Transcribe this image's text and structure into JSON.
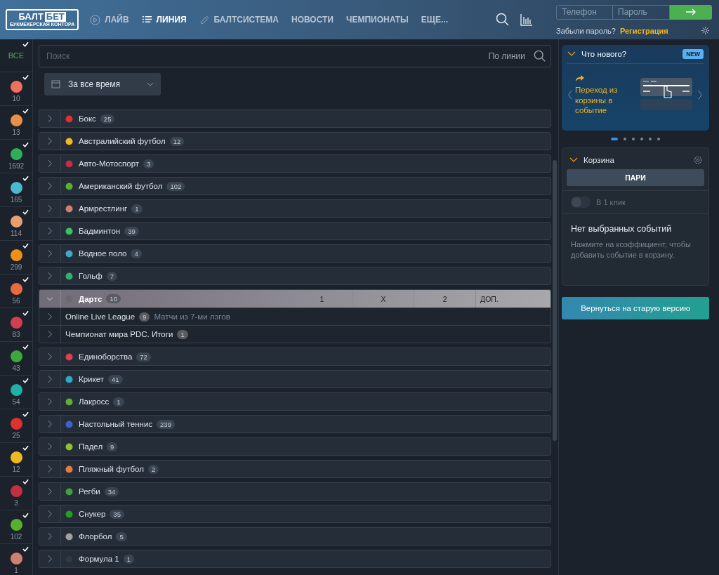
{
  "header": {
    "logo": {
      "top": "БАЛТ",
      "box": "БЕТ",
      "bottom": "БУКМЕКЕРСКАЯ КОНТОРА"
    },
    "nav": [
      {
        "label": "ЛАЙВ",
        "selected": false
      },
      {
        "label": "ЛИНИЯ",
        "selected": true
      },
      {
        "label": "БАЛТСИСТЕМА",
        "selected": false
      },
      {
        "label": "НОВОСТИ",
        "selected": false
      },
      {
        "label": "ЧЕМПИОНАТЫ",
        "selected": false
      },
      {
        "label": "ЕЩЕ...",
        "selected": false
      }
    ],
    "login": {
      "phone_placeholder": "Телефон",
      "password_placeholder": "Пароль",
      "forgot": "Забыли пароль?",
      "register": "Регистрация"
    }
  },
  "rail": [
    {
      "label": "ВСЕ",
      "checked": true
    },
    {
      "count": "10",
      "color": "#f07060",
      "checked": true
    },
    {
      "count": "13",
      "color": "#e8904a",
      "checked": true
    },
    {
      "count": "1692",
      "color": "#2fae5a",
      "checked": true
    },
    {
      "count": "165",
      "color": "#4bb8d0",
      "checked": true
    },
    {
      "count": "114",
      "color": "#e8a070",
      "checked": true
    },
    {
      "count": "299",
      "color": "#f0901a",
      "checked": true
    },
    {
      "count": "56",
      "color": "#e86a40",
      "checked": true
    },
    {
      "count": "83",
      "color": "#d04050",
      "checked": true
    },
    {
      "count": "43",
      "color": "#3ca83c",
      "checked": true
    },
    {
      "count": "54",
      "color": "#20b0a8",
      "checked": true
    },
    {
      "count": "25",
      "color": "#e03030",
      "checked": true
    },
    {
      "count": "12",
      "color": "#f0b820",
      "checked": true
    },
    {
      "count": "3",
      "color": "#c03040",
      "checked": true
    },
    {
      "count": "102",
      "color": "#58b030",
      "checked": true
    },
    {
      "count": "1",
      "color": "#d08070",
      "checked": true
    }
  ],
  "search": {
    "placeholder": "Поиск",
    "scope": "По линии"
  },
  "period": {
    "value": "За все время"
  },
  "sports": [
    {
      "name": "Бокс",
      "count": "25",
      "color": "#e03030",
      "expanded": false
    },
    {
      "name": "Австралийский футбол",
      "count": "12",
      "color": "#f0b820",
      "expanded": false
    },
    {
      "name": "Авто-Мотоспорт",
      "count": "3",
      "color": "#c03040",
      "expanded": false
    },
    {
      "name": "Американский футбол",
      "count": "102",
      "color": "#58b030",
      "expanded": false
    },
    {
      "name": "Армрестлинг",
      "count": "1",
      "color": "#d08070",
      "expanded": false
    },
    {
      "name": "Бадминтон",
      "count": "39",
      "color": "#3cc060",
      "expanded": false
    },
    {
      "name": "Водное поло",
      "count": "4",
      "color": "#40a8c0",
      "expanded": false
    },
    {
      "name": "Гольф",
      "count": "7",
      "color": "#30b070",
      "expanded": false
    },
    {
      "name": "Дартс",
      "count": "10",
      "color": "#6a6a6a",
      "expanded": true,
      "columns": [
        "1",
        "X",
        "2",
        "ДОП."
      ],
      "children": [
        {
          "name": "Online Live League",
          "count": "9",
          "note": "Матчи из 7-ми лэгов"
        },
        {
          "name": "Чемпионат мира PDC. Итоги",
          "count": "1"
        }
      ]
    },
    {
      "name": "Единоборства",
      "count": "72",
      "color": "#e04050",
      "expanded": false
    },
    {
      "name": "Крикет",
      "count": "41",
      "color": "#30a8c8",
      "expanded": false
    },
    {
      "name": "Лакросс",
      "count": "1",
      "color": "#60b030",
      "expanded": false
    },
    {
      "name": "Настольный теннис",
      "count": "239",
      "color": "#4060d0",
      "expanded": false
    },
    {
      "name": "Падел",
      "count": "9",
      "color": "#90c030",
      "expanded": false
    },
    {
      "name": "Пляжный футбол",
      "count": "2",
      "color": "#e08040",
      "expanded": false
    },
    {
      "name": "Регби",
      "count": "34",
      "color": "#40a040",
      "expanded": false
    },
    {
      "name": "Снукер",
      "count": "35",
      "color": "#20a020",
      "expanded": false
    },
    {
      "name": "Флорбол",
      "count": "5",
      "color": "#a0a0a0",
      "expanded": false
    },
    {
      "name": "Формула 1",
      "count": "1",
      "color": "#303840",
      "expanded": false
    }
  ],
  "whats_new": {
    "title": "Что нового?",
    "badge": "NEW",
    "text": "Переход из корзины в событие",
    "dots": [
      {
        "selected": true
      },
      {
        "selected": false
      },
      {
        "selected": false
      },
      {
        "selected": false
      },
      {
        "selected": false
      },
      {
        "selected": false
      }
    ]
  },
  "cart": {
    "title": "Корзина",
    "tab": "ПАРИ",
    "one_click": {
      "label": "В 1 клик",
      "on": false
    },
    "empty_title": "Нет выбранных событий",
    "empty_hint": "Нажмите на коэффициент, чтобы добавить событие в корзину."
  },
  "old_version_button": "Вернуться на старую версию"
}
